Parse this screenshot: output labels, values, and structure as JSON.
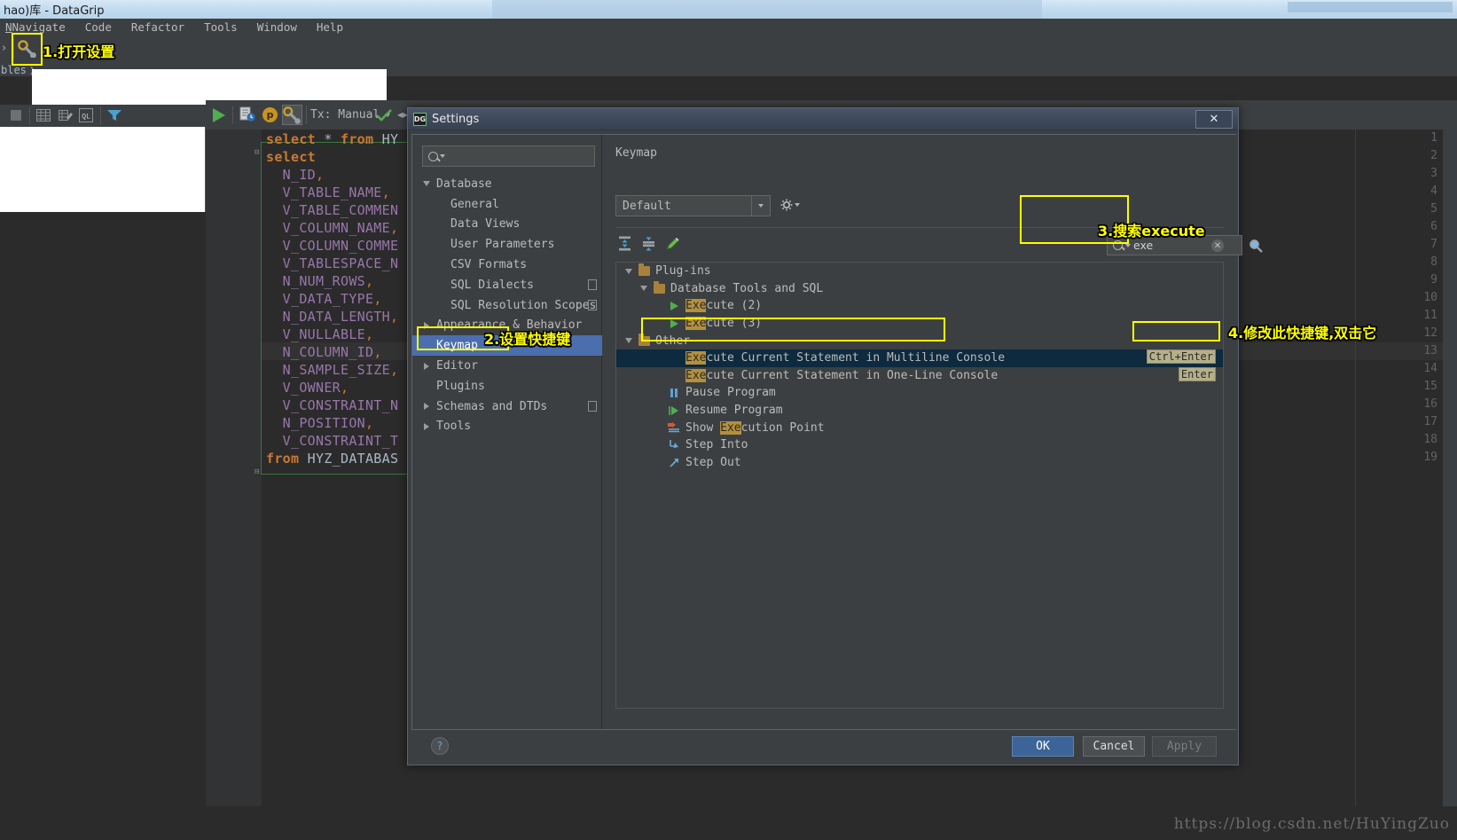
{
  "window": {
    "title": "hao)库 - DataGrip",
    "menu": [
      "Navigate",
      "Code",
      "Refactor",
      "Tools",
      "Window",
      "Help"
    ],
    "breadcrumb": "bles"
  },
  "ide_toolbar": {
    "settings_icon": "gear-wrench-icon"
  },
  "editor_toolbar": {
    "run_icon": "run-play-icon",
    "history_icon": "query-history-icon",
    "param_icon": "parameters-icon",
    "settings_icon": "gear-wrench-icon",
    "tx_label": "Tx: Manual",
    "commit_icon": "commit-check-icon"
  },
  "left_toolbar": {
    "icons": [
      "stop-icon",
      "table-icon",
      "edit-table-icon",
      "sql-icon",
      "filter-icon"
    ]
  },
  "editor": {
    "lines": [
      {
        "n": "1",
        "tokens": [
          {
            "t": "select",
            "c": "kw"
          },
          {
            "t": " * ",
            "c": "plain"
          },
          {
            "t": "from",
            "c": "kw"
          },
          {
            "t": " HY",
            "c": "plain"
          }
        ]
      },
      {
        "n": "2",
        "tokens": [
          {
            "t": "select",
            "c": "kw"
          }
        ]
      },
      {
        "n": "3",
        "tokens": [
          {
            "t": "  ",
            "c": "plain"
          },
          {
            "t": "N_ID",
            "c": "idp"
          },
          {
            "t": ",",
            "c": "op"
          }
        ]
      },
      {
        "n": "4",
        "tokens": [
          {
            "t": "  ",
            "c": "plain"
          },
          {
            "t": "V_TABLE_NAME",
            "c": "idp"
          },
          {
            "t": ",",
            "c": "op"
          }
        ]
      },
      {
        "n": "5",
        "tokens": [
          {
            "t": "  ",
            "c": "plain"
          },
          {
            "t": "V_TABLE_COMMEN",
            "c": "idp"
          }
        ]
      },
      {
        "n": "6",
        "tokens": [
          {
            "t": "  ",
            "c": "plain"
          },
          {
            "t": "V_COLUMN_NAME",
            "c": "idp"
          },
          {
            "t": ",",
            "c": "op"
          }
        ]
      },
      {
        "n": "7",
        "tokens": [
          {
            "t": "  ",
            "c": "plain"
          },
          {
            "t": "V_COLUMN_COMME",
            "c": "idp"
          }
        ]
      },
      {
        "n": "8",
        "tokens": [
          {
            "t": "  ",
            "c": "plain"
          },
          {
            "t": "V_TABLESPACE_N",
            "c": "idp"
          }
        ]
      },
      {
        "n": "9",
        "tokens": [
          {
            "t": "  ",
            "c": "plain"
          },
          {
            "t": "N_NUM_ROWS",
            "c": "idp"
          },
          {
            "t": ",",
            "c": "op"
          }
        ]
      },
      {
        "n": "10",
        "tokens": [
          {
            "t": "  ",
            "c": "plain"
          },
          {
            "t": "V_DATA_TYPE",
            "c": "idp"
          },
          {
            "t": ",",
            "c": "op"
          }
        ]
      },
      {
        "n": "11",
        "tokens": [
          {
            "t": "  ",
            "c": "plain"
          },
          {
            "t": "N_DATA_LENGTH",
            "c": "idp"
          },
          {
            "t": ",",
            "c": "op"
          }
        ]
      },
      {
        "n": "12",
        "tokens": [
          {
            "t": "  ",
            "c": "plain"
          },
          {
            "t": "V_NULLABLE",
            "c": "idp"
          },
          {
            "t": ",",
            "c": "op"
          }
        ]
      },
      {
        "n": "13",
        "tokens": [
          {
            "t": "  ",
            "c": "plain"
          },
          {
            "t": "N_COLUMN_ID",
            "c": "idp"
          },
          {
            "t": ",",
            "c": "op"
          }
        ]
      },
      {
        "n": "14",
        "tokens": [
          {
            "t": "  ",
            "c": "plain"
          },
          {
            "t": "N_SAMPLE_SIZE",
            "c": "idp"
          },
          {
            "t": ",",
            "c": "op"
          }
        ]
      },
      {
        "n": "15",
        "tokens": [
          {
            "t": "  ",
            "c": "plain"
          },
          {
            "t": "V_OWNER",
            "c": "idp"
          },
          {
            "t": ",",
            "c": "op"
          }
        ]
      },
      {
        "n": "16",
        "tokens": [
          {
            "t": "  ",
            "c": "plain"
          },
          {
            "t": "V_CONSTRAINT_N",
            "c": "idp"
          }
        ]
      },
      {
        "n": "17",
        "tokens": [
          {
            "t": "  ",
            "c": "plain"
          },
          {
            "t": "N_POSITION",
            "c": "idp"
          },
          {
            "t": ",",
            "c": "op"
          }
        ]
      },
      {
        "n": "18",
        "tokens": [
          {
            "t": "  ",
            "c": "plain"
          },
          {
            "t": "V_CONSTRAINT_T",
            "c": "idp"
          }
        ]
      },
      {
        "n": "19",
        "tokens": [
          {
            "t": "from",
            "c": "kw"
          },
          {
            "t": " HYZ_DATABAS",
            "c": "plain"
          }
        ]
      }
    ]
  },
  "dialog": {
    "title": "Settings",
    "close_label": "✕",
    "search_placeholder": "",
    "tree": [
      {
        "label": "Database",
        "indent": 0,
        "arrow": "down",
        "selected": false
      },
      {
        "label": "General",
        "indent": 1,
        "arrow": "none",
        "selected": false
      },
      {
        "label": "Data Views",
        "indent": 1,
        "arrow": "none",
        "selected": false
      },
      {
        "label": "User Parameters",
        "indent": 1,
        "arrow": "none",
        "selected": false
      },
      {
        "label": "CSV Formats",
        "indent": 1,
        "arrow": "none",
        "selected": false
      },
      {
        "label": "SQL Dialects",
        "indent": 1,
        "arrow": "none",
        "selected": false,
        "badge": true
      },
      {
        "label": "SQL Resolution Scopes",
        "indent": 1,
        "arrow": "none",
        "selected": false,
        "badge": true
      },
      {
        "label": "Appearance & Behavior",
        "indent": 0,
        "arrow": "right",
        "selected": false
      },
      {
        "label": "Keymap",
        "indent": 0,
        "arrow": "none",
        "selected": true
      },
      {
        "label": "Editor",
        "indent": 0,
        "arrow": "right",
        "selected": false
      },
      {
        "label": "Plugins",
        "indent": 0,
        "arrow": "none",
        "selected": false
      },
      {
        "label": "Schemas and DTDs",
        "indent": 0,
        "arrow": "right",
        "selected": false,
        "badge": true
      },
      {
        "label": "Tools",
        "indent": 0,
        "arrow": "right",
        "selected": false
      }
    ],
    "keymap": {
      "heading": "Keymap",
      "profile": "Default",
      "gear_icon": "gear-icon",
      "tool_icons": [
        "expand-all-icon",
        "collapse-all-icon",
        "edit-shortcut-icon"
      ],
      "search_value": "exe",
      "search_clear_icon": "clear-icon",
      "search_find_icon": "find-icon",
      "rows": [
        {
          "indent": 0,
          "icon": "expand-arrow-down",
          "folder": true,
          "pre": "",
          "hl": "",
          "post": "Plug-ins",
          "shortcut": "",
          "selected": false
        },
        {
          "indent": 1,
          "icon": "expand-arrow-down",
          "folder": true,
          "pre": "",
          "hl": "",
          "post": "Database Tools and SQL",
          "shortcut": "",
          "selected": false
        },
        {
          "indent": 2,
          "icon": "play-green",
          "folder": false,
          "pre": "",
          "hl": "Exe",
          "post": "cute (2)",
          "shortcut": "",
          "selected": false
        },
        {
          "indent": 2,
          "icon": "play-green",
          "folder": false,
          "pre": "",
          "hl": "Exe",
          "post": "cute (3)",
          "shortcut": "",
          "selected": false
        },
        {
          "indent": 0,
          "icon": "expand-arrow-down",
          "folder": true,
          "pre": "",
          "hl": "",
          "post": "Other",
          "shortcut": "",
          "selected": false
        },
        {
          "indent": 2,
          "icon": "none",
          "folder": false,
          "pre": "",
          "hl": "Exe",
          "post": "cute Current Statement in Multiline Console",
          "shortcut": "Ctrl+Enter",
          "selected": true
        },
        {
          "indent": 2,
          "icon": "none",
          "folder": false,
          "pre": "",
          "hl": "Exe",
          "post": "cute Current Statement in One-Line Console",
          "shortcut": "Enter",
          "selected": false
        },
        {
          "indent": 2,
          "icon": "pause",
          "folder": false,
          "pre": "",
          "hl": "",
          "post": "Pause Program",
          "shortcut": "",
          "selected": false
        },
        {
          "indent": 2,
          "icon": "resume",
          "folder": false,
          "pre": "",
          "hl": "",
          "post": "Resume Program",
          "shortcut": "",
          "selected": false
        },
        {
          "indent": 2,
          "icon": "showexec",
          "folder": false,
          "pre": "Show ",
          "hl": "Exe",
          "post": "cution Point",
          "shortcut": "",
          "selected": false
        },
        {
          "indent": 2,
          "icon": "stepinto",
          "folder": false,
          "pre": "",
          "hl": "",
          "post": "Step Into",
          "shortcut": "",
          "selected": false
        },
        {
          "indent": 2,
          "icon": "stepout",
          "folder": false,
          "pre": "",
          "hl": "",
          "post": "Step Out",
          "shortcut": "",
          "selected": false
        }
      ]
    },
    "footer": {
      "help_label": "?",
      "ok": "OK",
      "cancel": "Cancel",
      "apply": "Apply"
    }
  },
  "annotations": {
    "a1": "1.打开设置",
    "a2": "2.设置快捷键",
    "a3": "3.搜索execute",
    "a4": "4.修改此快捷键,双击它"
  },
  "watermark": "https://blog.csdn.net/HuYingZuo"
}
